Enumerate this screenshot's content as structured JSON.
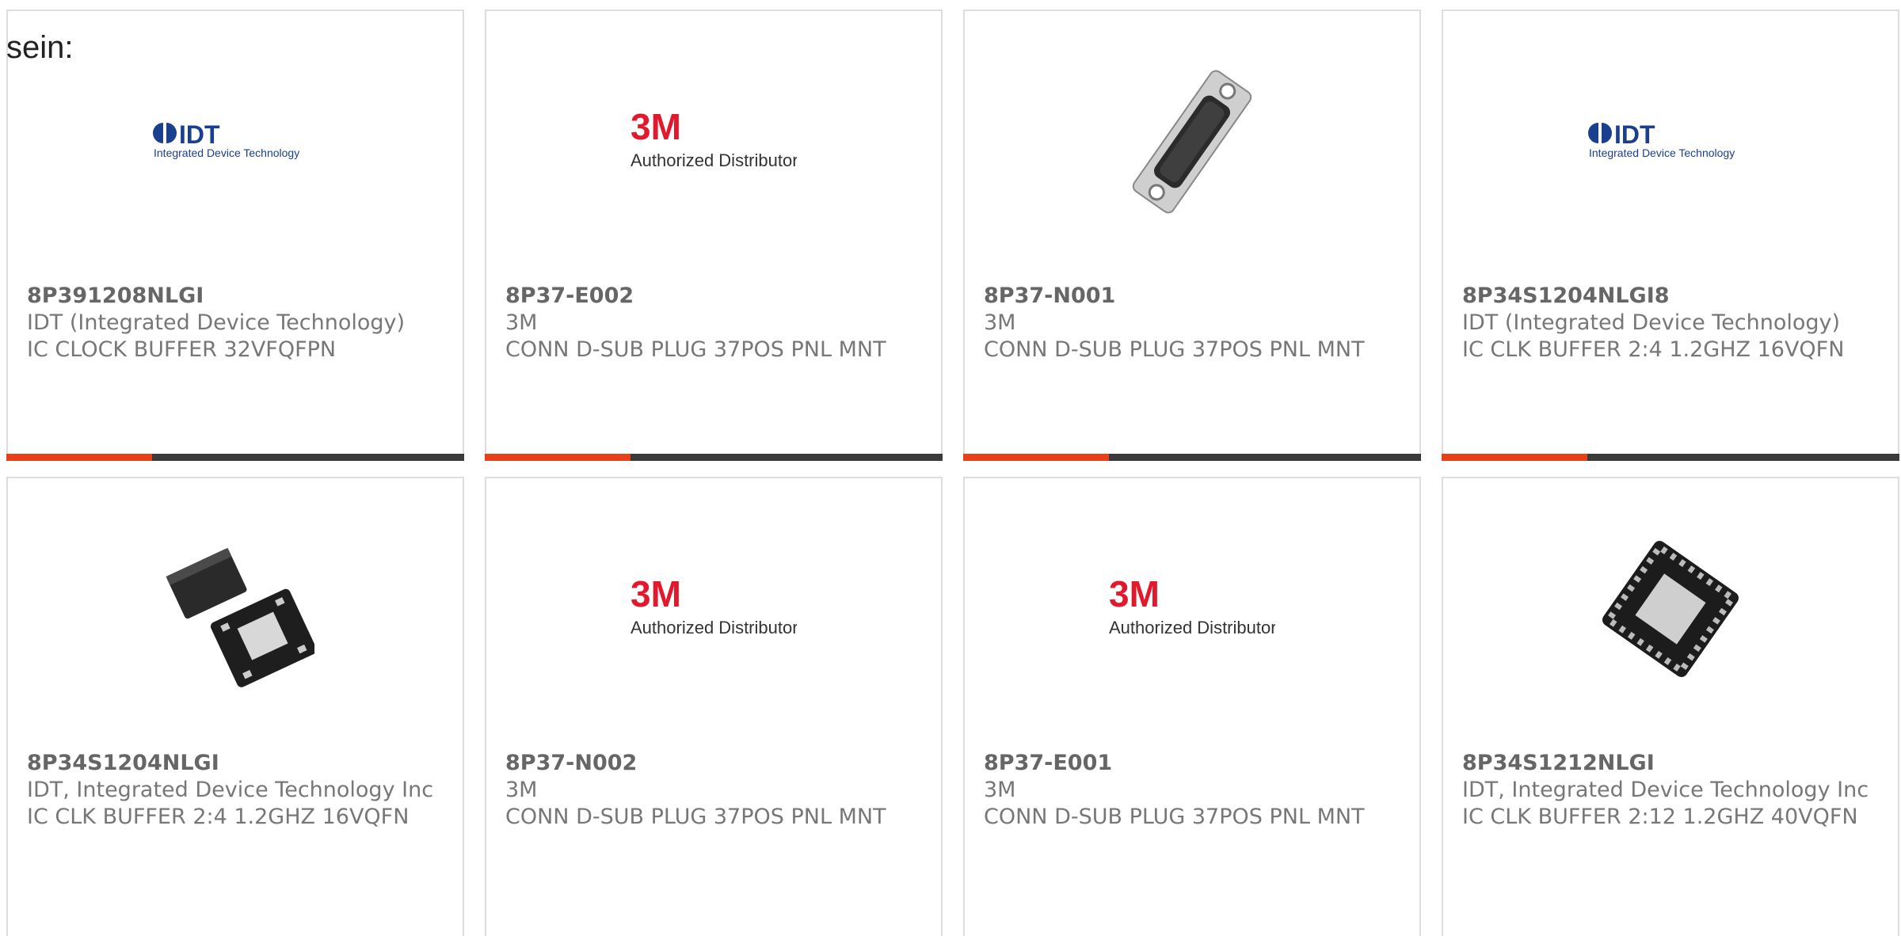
{
  "intro_text": "sein:",
  "accent_color": "#e8411a",
  "bar_color": "#3a3a3a",
  "cards": [
    {
      "part": "8P391208NLGI",
      "mfr": "IDT (Integrated Device Technology)",
      "desc": "IC CLOCK BUFFER 32VFQFPN",
      "image": "idt-logo"
    },
    {
      "part": "8P37-E002",
      "mfr": "3M",
      "desc": "CONN D-SUB PLUG 37POS PNL MNT",
      "image": "3m-authorized-distributor-logo",
      "logo_brand": "3M",
      "logo_caption": "Authorized Distributor"
    },
    {
      "part": "8P37-N001",
      "mfr": "3M",
      "desc": "CONN D-SUB PLUG 37POS PNL MNT",
      "image": "dsub-connector-photo"
    },
    {
      "part": "8P34S1204NLGI8",
      "mfr": "IDT (Integrated Device Technology)",
      "desc": "IC CLK BUFFER 2:4 1.2GHZ 16VQFN",
      "image": "idt-logo"
    },
    {
      "part": "8P34S1204NLGI",
      "mfr": "IDT, Integrated Device Technology Inc",
      "desc": "IC CLK BUFFER 2:4 1.2GHZ 16VQFN",
      "image": "qfn-chip-photo"
    },
    {
      "part": "8P37-N002",
      "mfr": "3M",
      "desc": "CONN D-SUB PLUG 37POS PNL MNT",
      "image": "3m-authorized-distributor-logo",
      "logo_brand": "3M",
      "logo_caption": "Authorized Distributor"
    },
    {
      "part": "8P37-E001",
      "mfr": "3M",
      "desc": "CONN D-SUB PLUG 37POS PNL MNT",
      "image": "3m-authorized-distributor-logo",
      "logo_brand": "3M",
      "logo_caption": "Authorized Distributor"
    },
    {
      "part": "8P34S1212NLGI",
      "mfr": "IDT, Integrated Device Technology Inc",
      "desc": "IC CLK BUFFER 2:12 1.2GHZ 40VQFN",
      "image": "qfn40-chip-photo"
    }
  ]
}
